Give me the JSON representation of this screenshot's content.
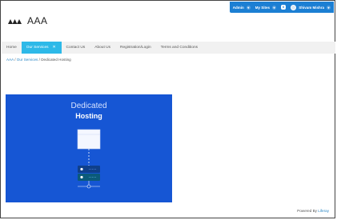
{
  "dockbar": {
    "items": [
      {
        "label": "Admin"
      },
      {
        "label": "My Sites"
      }
    ],
    "notification_count": "0",
    "user_name": "Shivam Mishra"
  },
  "site": {
    "name": "AAA"
  },
  "nav": {
    "items": [
      "Home",
      "Our Services",
      "Contact Us",
      "About Us",
      "Registration/Login",
      "Terms and Conditions"
    ]
  },
  "breadcrumb": {
    "root": "AAA",
    "sep1": " / ",
    "parent": "Our Services",
    "sep2": " / ",
    "current": "Dedicated Hosting"
  },
  "hero": {
    "title": "Dedicated",
    "subtitle": "Hosting",
    "background_color": "#1656d4"
  },
  "footer": {
    "powered_prefix": "Powered By ",
    "powered_link": "Liferay"
  },
  "colors": {
    "dock": "#1c7fd3",
    "nav_active": "#2db9e8",
    "link": "#2a87c5"
  }
}
